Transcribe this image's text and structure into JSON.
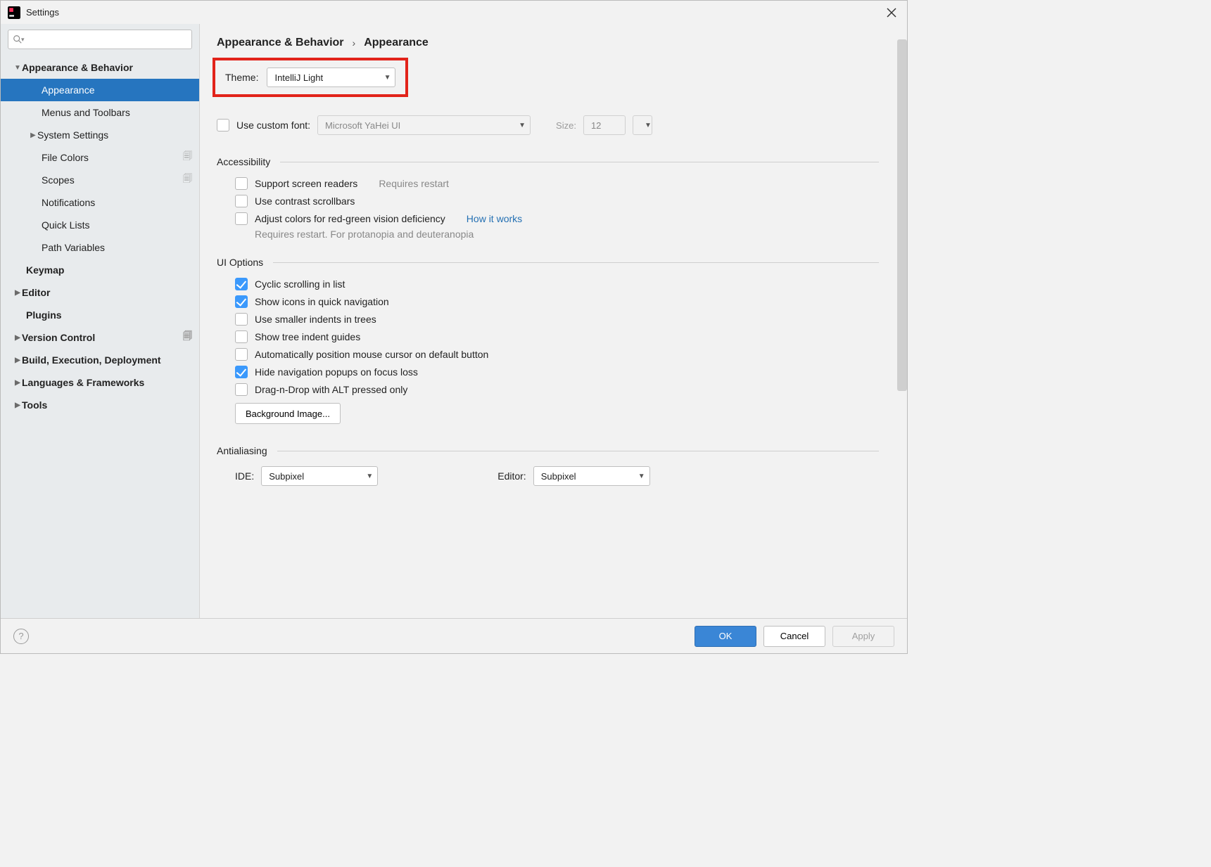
{
  "window": {
    "title": "Settings"
  },
  "search": {
    "placeholder": ""
  },
  "sidebar": {
    "items": [
      {
        "label": "Appearance & Behavior"
      },
      {
        "label": "Appearance"
      },
      {
        "label": "Menus and Toolbars"
      },
      {
        "label": "System Settings"
      },
      {
        "label": "File Colors"
      },
      {
        "label": "Scopes"
      },
      {
        "label": "Notifications"
      },
      {
        "label": "Quick Lists"
      },
      {
        "label": "Path Variables"
      },
      {
        "label": "Keymap"
      },
      {
        "label": "Editor"
      },
      {
        "label": "Plugins"
      },
      {
        "label": "Version Control"
      },
      {
        "label": "Build, Execution, Deployment"
      },
      {
        "label": "Languages & Frameworks"
      },
      {
        "label": "Tools"
      }
    ]
  },
  "breadcrumb": {
    "parent": "Appearance & Behavior",
    "current": "Appearance"
  },
  "theme": {
    "label": "Theme:",
    "value": "IntelliJ Light"
  },
  "font": {
    "use_custom_label": "Use custom font:",
    "font_value": "Microsoft YaHei UI",
    "size_label": "Size:",
    "size_value": "12"
  },
  "accessibility": {
    "header": "Accessibility",
    "support_readers": "Support screen readers",
    "requires_restart": "Requires restart",
    "contrast_scrollbars": "Use contrast scrollbars",
    "adjust_colors": "Adjust colors for red-green vision deficiency",
    "how_it_works": "How it works",
    "adjust_note": "Requires restart. For protanopia and deuteranopia"
  },
  "ui_options": {
    "header": "UI Options",
    "cyclic": "Cyclic scrolling in list",
    "icons_quick": "Show icons in quick navigation",
    "smaller_indents": "Use smaller indents in trees",
    "tree_guides": "Show tree indent guides",
    "auto_cursor": "Automatically position mouse cursor on default button",
    "hide_popups": "Hide navigation popups on focus loss",
    "drag_alt": "Drag-n-Drop with ALT pressed only",
    "bg_image_btn": "Background Image..."
  },
  "antialiasing": {
    "header": "Antialiasing",
    "ide_label": "IDE:",
    "ide_value": "Subpixel",
    "editor_label": "Editor:",
    "editor_value": "Subpixel"
  },
  "footer": {
    "ok": "OK",
    "cancel": "Cancel",
    "apply": "Apply"
  }
}
